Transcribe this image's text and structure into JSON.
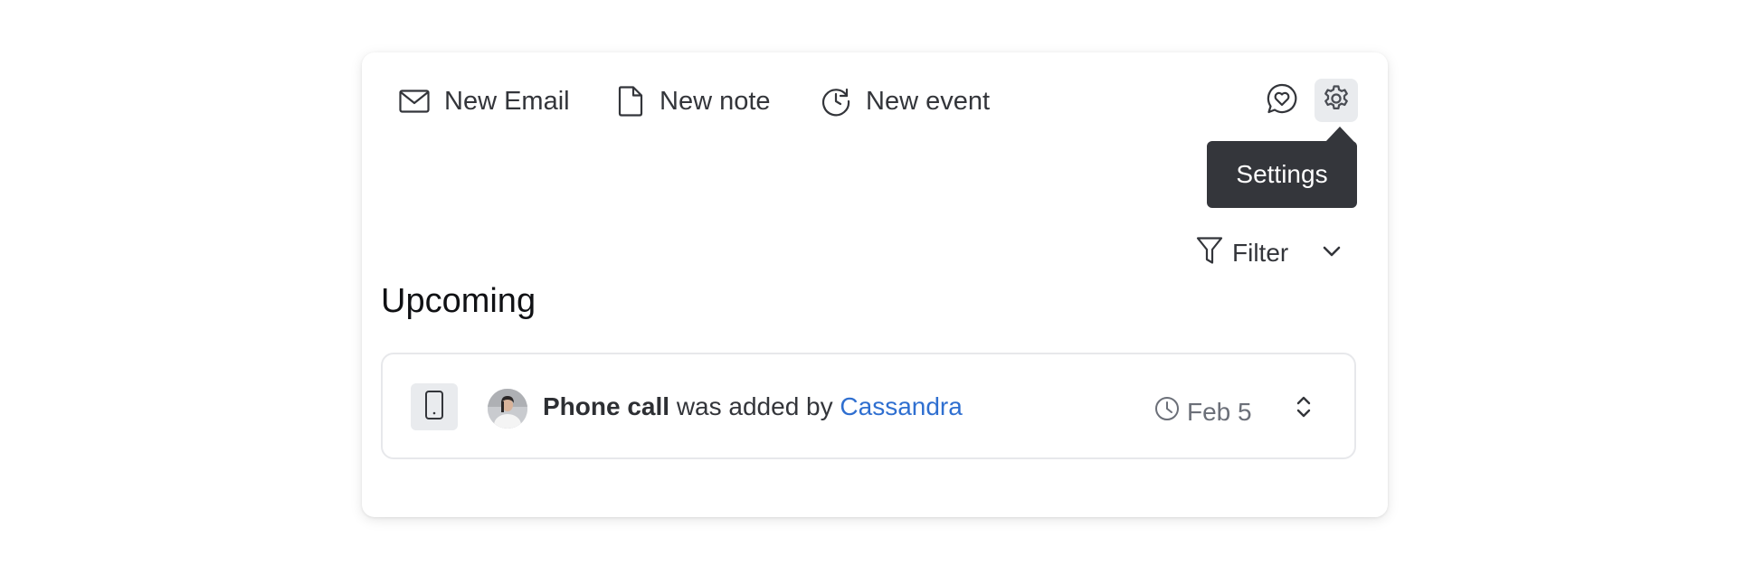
{
  "toolbar": {
    "new_email_label": "New Email",
    "new_note_label": "New note",
    "new_event_label": "New event"
  },
  "icons": {
    "email": "mail-icon",
    "note": "document-icon",
    "event": "clock-refresh-icon",
    "feedback": "chat-heart-icon",
    "settings": "gear-icon",
    "filter": "funnel-icon",
    "chevron": "chevron-down-icon",
    "phone": "phone-icon",
    "date": "clock-icon",
    "expand": "expand-icon"
  },
  "tooltip": {
    "text": "Settings"
  },
  "filter": {
    "label": "Filter"
  },
  "section": {
    "title": "Upcoming"
  },
  "activity": {
    "type": "Phone call",
    "text": "was added by",
    "user": "Cassandra",
    "date": "Feb 5"
  },
  "colors": {
    "link": "#2f6fd0",
    "tooltip_bg": "#34363b",
    "active_bg": "#e9ebee"
  }
}
